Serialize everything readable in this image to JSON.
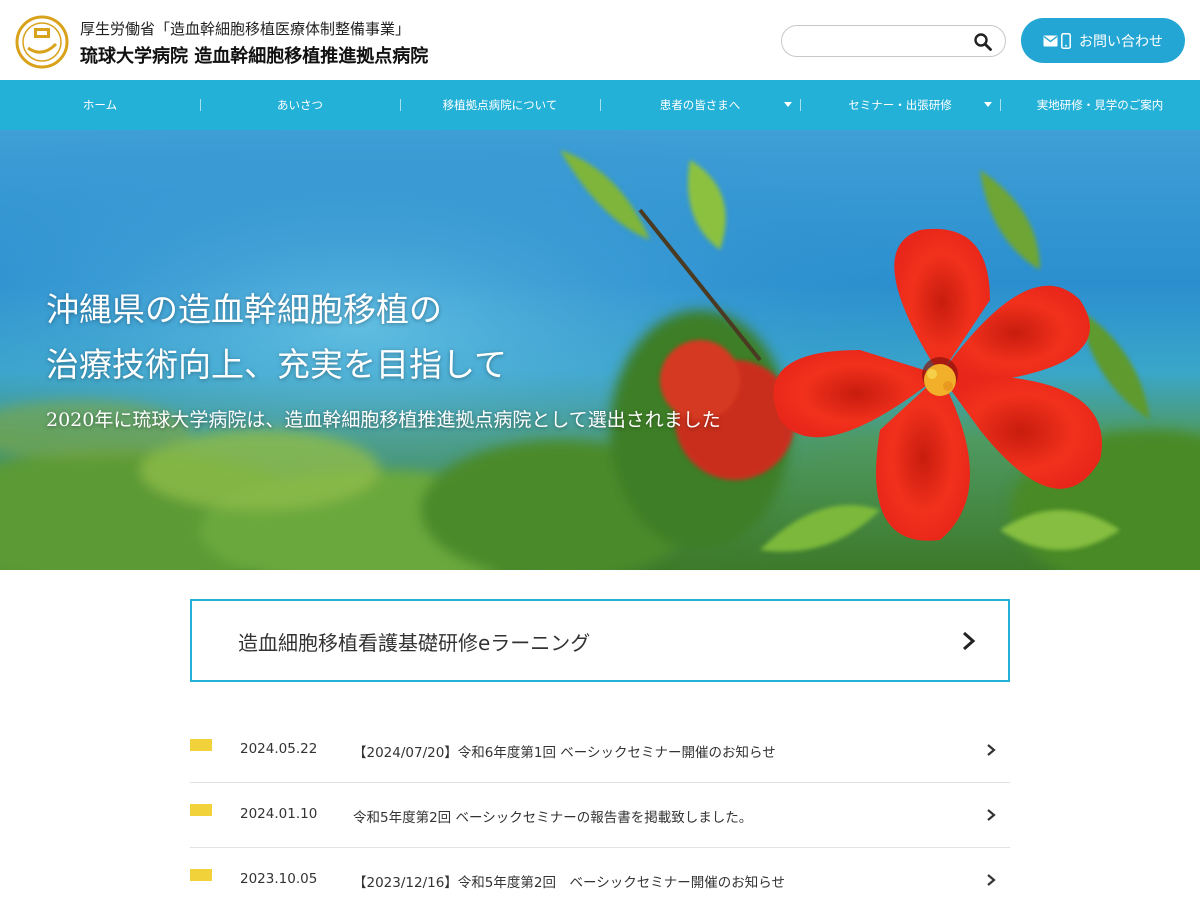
{
  "header": {
    "subtitle": "厚生労働省「造血幹細胞移植医療体制整備事業」",
    "title": "琉球大学病院 造血幹細胞移植推進拠点病院",
    "search_placeholder": "",
    "contact_label": "お問い合わせ"
  },
  "nav": {
    "items": [
      {
        "label": "ホーム",
        "has_dropdown": false
      },
      {
        "label": "あいさつ",
        "has_dropdown": false
      },
      {
        "label": "移植拠点病院について",
        "has_dropdown": false
      },
      {
        "label": "患者の皆さまへ",
        "has_dropdown": true
      },
      {
        "label": "セミナー・出張研修",
        "has_dropdown": true
      },
      {
        "label": "実地研修・見学のご案内",
        "has_dropdown": false
      }
    ]
  },
  "hero": {
    "headline_line1": "沖縄県の造血幹細胞移植の",
    "headline_line2": "治療技術向上、充実を目指して",
    "subtext": "2020年に琉球大学病院は、造血幹細胞移植推進拠点病院として選出されました"
  },
  "banner": {
    "label": "造血細胞移植看護基礎研修eラーニング"
  },
  "news": [
    {
      "date": "2024.05.22",
      "title": "【2024/07/20】令和6年度第1回 ベーシックセミナー開催のお知らせ"
    },
    {
      "date": "2024.01.10",
      "title": "令和5年度第2回 ベーシックセミナーの報告書を掲載致しました。"
    },
    {
      "date": "2023.10.05",
      "title": "【2023/12/16】令和5年度第2回　ベーシックセミナー開催のお知らせ"
    }
  ],
  "colors": {
    "accent": "#23b1d8",
    "button": "#23a6d3",
    "news_tag": "#f2d23a",
    "logo": "#d9a21b"
  },
  "icons": {
    "search": "search-icon",
    "mail": "mail-icon",
    "phone": "phone-icon",
    "chevron": "chevron-right-icon",
    "caret": "caret-down-icon"
  }
}
